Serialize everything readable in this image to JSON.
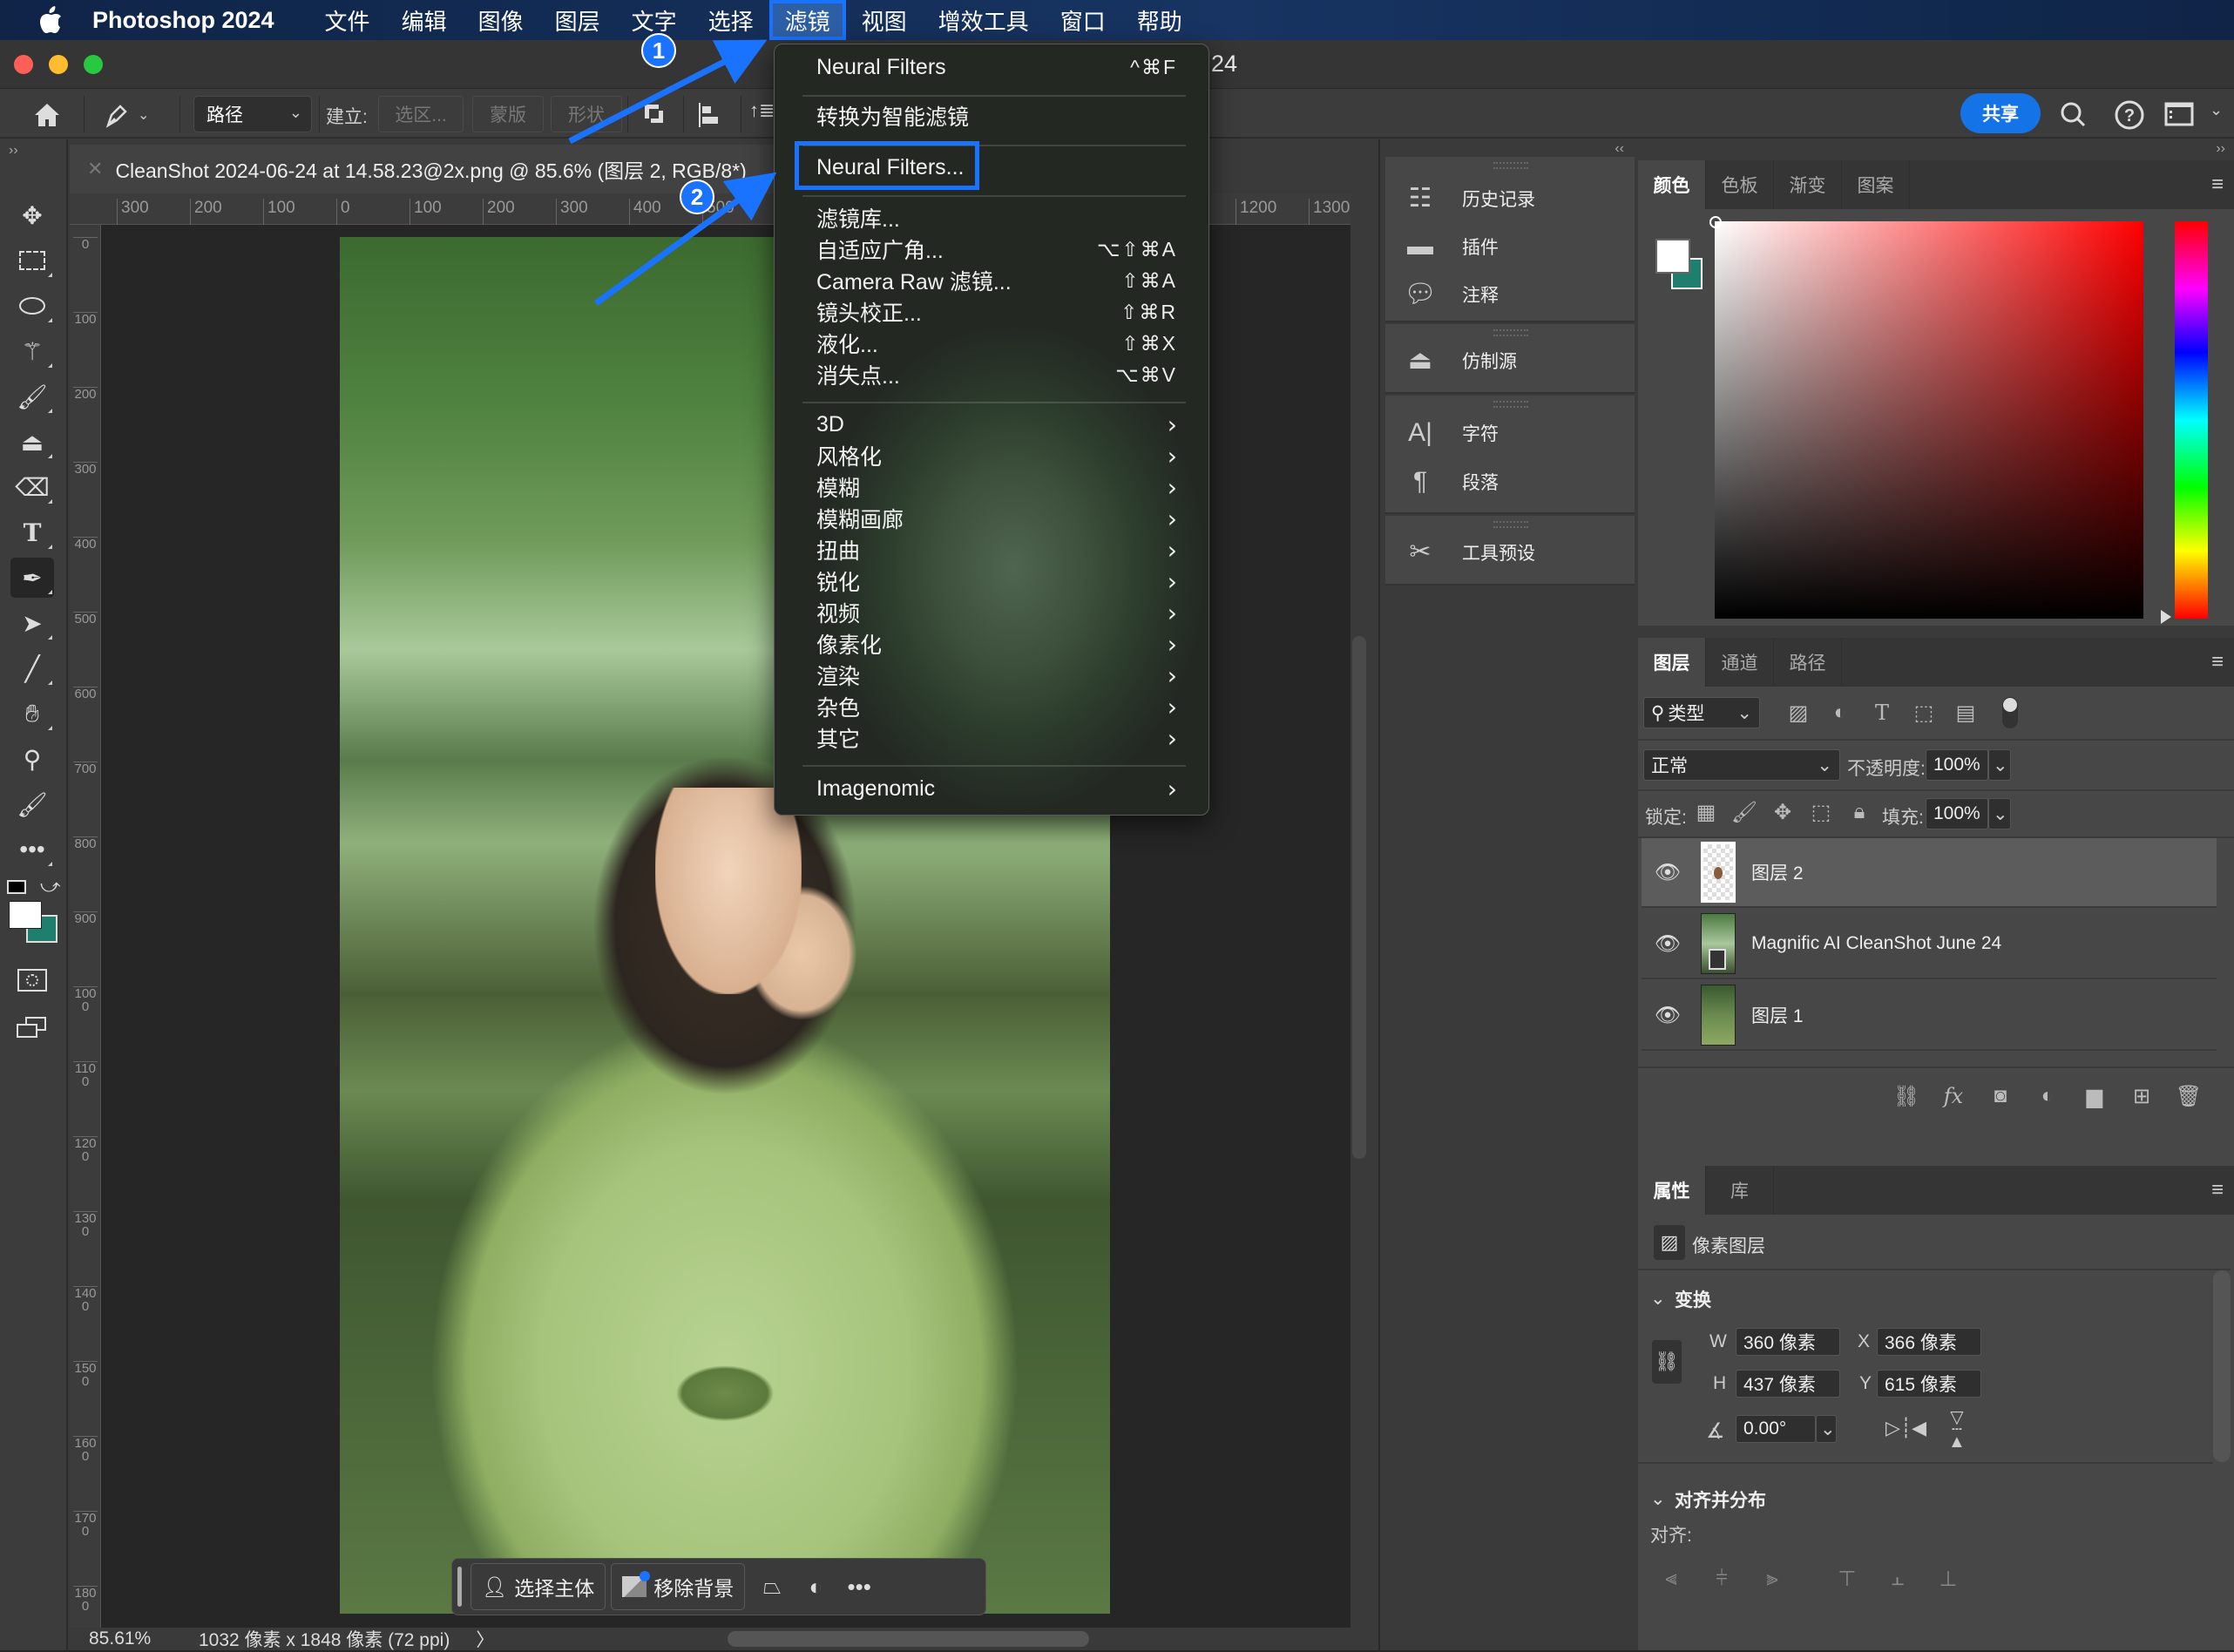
{
  "menubar": {
    "app_name": "Photoshop 2024",
    "items": [
      "文件",
      "编辑",
      "图像",
      "图层",
      "文字",
      "选择",
      "滤镜",
      "视图",
      "增效工具",
      "窗口",
      "帮助"
    ],
    "active_item": "滤镜"
  },
  "window": {
    "title_suffix": "24"
  },
  "options_bar": {
    "mode_select": "路径",
    "create_label": "建立:",
    "selection_btn": "选区...",
    "mask_btn": "蒙版",
    "shape_btn": "形状",
    "share_label": "共享"
  },
  "document": {
    "tab_title": "CleanShot 2024-06-24 at 14.58.23@2x.png @ 85.6% (图层 2, RGB/8*)",
    "h_ruler": [
      "300",
      "200",
      "100",
      "0",
      "100",
      "200",
      "300",
      "400",
      "500",
      "1200",
      "1300"
    ],
    "v_ruler": [
      "0",
      "100",
      "200",
      "300",
      "400",
      "500",
      "600",
      "700",
      "800",
      "900",
      "1000",
      "1100",
      "1200",
      "1300",
      "1400",
      "1500",
      "1600",
      "1700",
      "1800"
    ]
  },
  "filter_menu": {
    "top_items": [
      {
        "label": "Neural Filters",
        "shortcut": "^⌘F"
      },
      {
        "label": "转换为智能滤镜",
        "shortcut": ""
      },
      {
        "label": "Neural Filters...",
        "shortcut": "",
        "highlighted": true
      }
    ],
    "filter_items": [
      {
        "label": "滤镜库...",
        "shortcut": ""
      },
      {
        "label": "自适应广角...",
        "shortcut": "⌥⇧⌘A"
      },
      {
        "label": "Camera Raw 滤镜...",
        "shortcut": "⇧⌘A"
      },
      {
        "label": "镜头校正...",
        "shortcut": "⇧⌘R"
      },
      {
        "label": "液化...",
        "shortcut": "⇧⌘X"
      },
      {
        "label": "消失点...",
        "shortcut": "⌥⌘V"
      }
    ],
    "submenus": [
      "3D",
      "风格化",
      "模糊",
      "模糊画廊",
      "扭曲",
      "锐化",
      "视频",
      "像素化",
      "渲染",
      "杂色",
      "其它"
    ],
    "plugins": [
      "Imagenomic"
    ]
  },
  "annotations": [
    {
      "number": "1",
      "target": "滤镜"
    },
    {
      "number": "2",
      "target": "Neural Filters..."
    }
  ],
  "context_bar": {
    "select_subject": "选择主体",
    "remove_background": "移除背景"
  },
  "status_bar": {
    "zoom": "85.61%",
    "doc_info": "1032 像素 x 1848 像素 (72 ppi)",
    "more": "〉"
  },
  "dock": {
    "groups": [
      [
        "历史记录",
        "插件",
        "注释"
      ],
      [
        "仿制源"
      ],
      [
        "字符",
        "段落"
      ],
      [
        "工具预设"
      ]
    ]
  },
  "color_panel": {
    "tabs": [
      "颜色",
      "色板",
      "渐变",
      "图案"
    ],
    "active_tab": "颜色",
    "foreground": "#ffffff",
    "background": "#1e7f6e",
    "hue_color": "#ff0000"
  },
  "layers_panel": {
    "tabs": [
      "图层",
      "通道",
      "路径"
    ],
    "active_tab": "图层",
    "filter_kind": "类型",
    "blend_mode": "正常",
    "opacity_label": "不透明度:",
    "opacity": "100%",
    "lock_label": "锁定:",
    "fill_label": "填充:",
    "fill": "100%",
    "layers": [
      {
        "name": "图层 2",
        "visible": true,
        "selected": true
      },
      {
        "name": "Magnific AI CleanShot June 24",
        "visible": true,
        "selected": false
      },
      {
        "name": "图层 1",
        "visible": true,
        "selected": false
      }
    ]
  },
  "properties_panel": {
    "tabs": [
      "属性",
      "库"
    ],
    "active_tab": "属性",
    "layer_type": "像素图层",
    "transform_section": "变换",
    "w_label": "W",
    "w": "360 像素",
    "h_label": "H",
    "h": "437 像素",
    "x_label": "X",
    "x": "366 像素",
    "y_label": "Y",
    "y": "615 像素",
    "angle": "0.00°",
    "align_section": "对齐并分布",
    "align_label": "对齐:"
  }
}
